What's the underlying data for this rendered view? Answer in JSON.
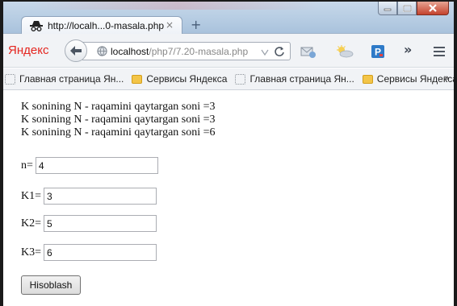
{
  "browser": {
    "tab_title": "http://localh...0-masala.php",
    "tab_close": "×",
    "new_tab": "+",
    "brand": "Яндекс",
    "url_host": "localhost",
    "url_path": "/php7/7.20-masala.php",
    "overflow": "»",
    "bookmarks": [
      {
        "label": "Главная страница Ян...",
        "icon": "page-icon"
      },
      {
        "label": "Сервисы Яндекса",
        "icon": "folder-icon"
      },
      {
        "label": "Главная страница Ян...",
        "icon": "page-icon"
      },
      {
        "label": "Сервисы Яндекса",
        "icon": "folder-icon"
      }
    ],
    "bookmarks_more": "»"
  },
  "content": {
    "results": [
      "K sonining N - raqamini qaytargan soni =3",
      "K sonining N - raqamini qaytargan soni =3",
      "K sonining N - raqamini qaytargan soni =6"
    ],
    "fields": [
      {
        "label": "n=",
        "value": "4"
      },
      {
        "label": "K1=",
        "value": "3"
      },
      {
        "label": "K2=",
        "value": "5"
      },
      {
        "label": "K3=",
        "value": "6"
      }
    ],
    "submit_label": "Hisoblash"
  },
  "colors": {
    "accent_red": "#e52620",
    "folder": "#f3c548",
    "titlebar": "#b7cde3"
  }
}
